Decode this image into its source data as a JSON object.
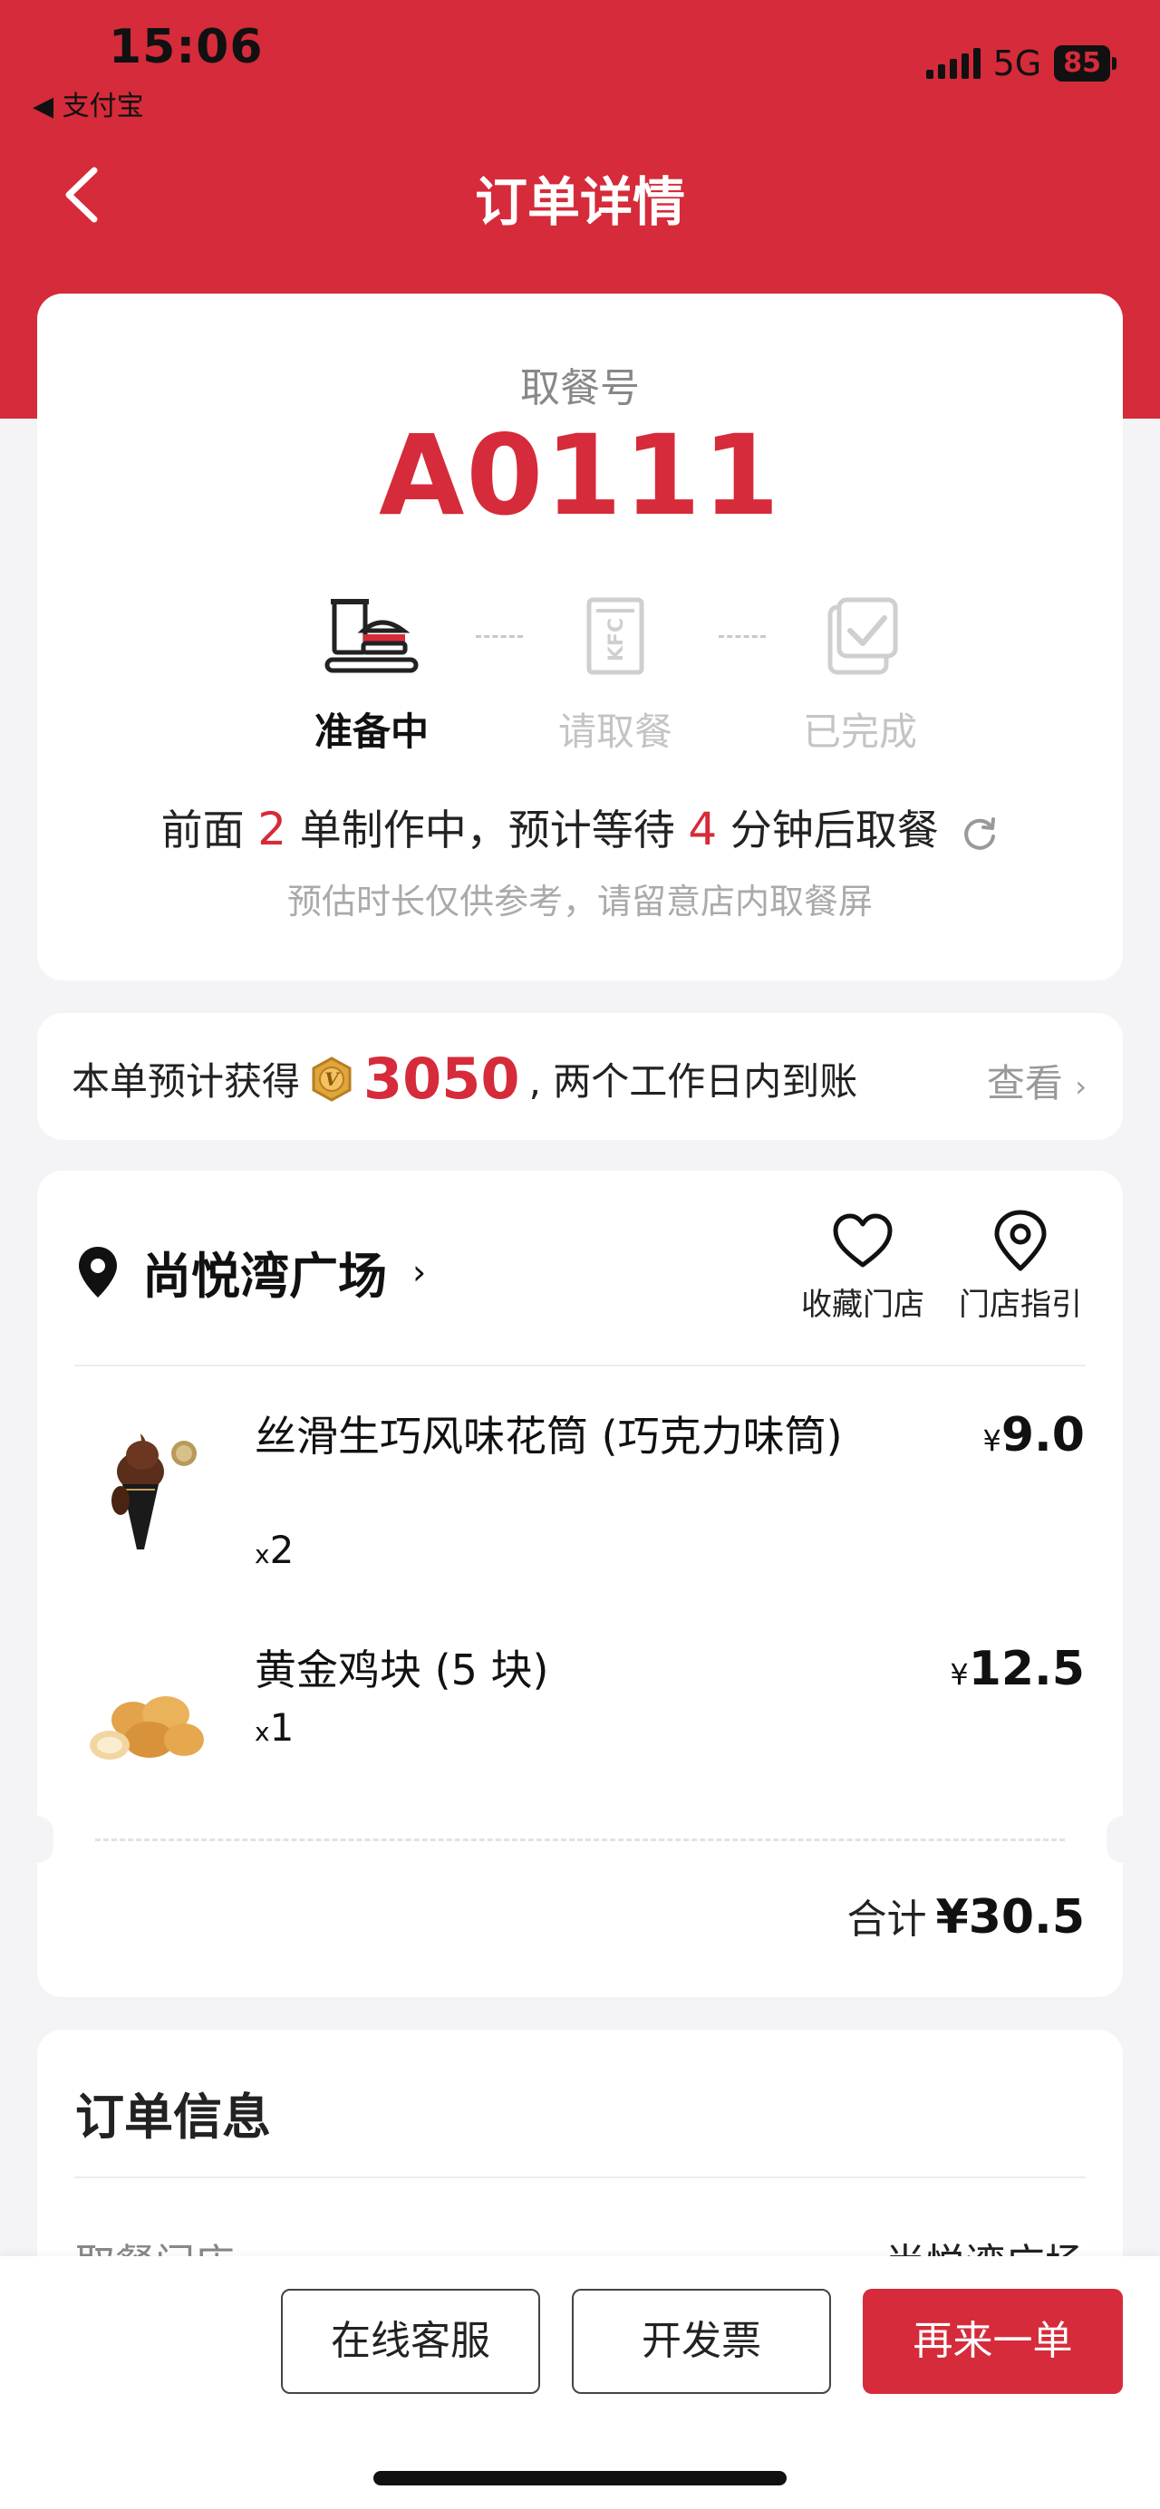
{
  "status_bar": {
    "time": "15:06",
    "back_app": "◀ 支付宝",
    "network": "5G",
    "battery": "85"
  },
  "nav": {
    "title": "订单详情",
    "back_icon": "chevron-left-icon"
  },
  "pickup": {
    "label": "取餐号",
    "number": "A0111",
    "steps": [
      {
        "label": "准备中",
        "icon": "burger-tray-icon",
        "active": true
      },
      {
        "label": "请取餐",
        "icon": "kfc-bag-icon",
        "active": false
      },
      {
        "label": "已完成",
        "icon": "check-bag-icon",
        "active": false
      }
    ],
    "wait": {
      "prefix": "前面",
      "orders_ahead": "2",
      "middle": "单制作中，预计等待",
      "minutes": "4",
      "suffix": "分钟后取餐"
    },
    "note": "预估时长仅供参考，请留意店内取餐屏"
  },
  "points": {
    "prefix": "本单预计获得",
    "amount": "3050",
    "suffix": ", 两个工作日内到账",
    "view_label": "查看"
  },
  "store": {
    "name": "尚悦湾广场",
    "fav_label": "收藏门店",
    "guide_label": "门店指引"
  },
  "items": [
    {
      "name": "丝滑生巧风味花筒 (巧克力味筒)",
      "qty": "2",
      "price": "9.0",
      "currency": "¥",
      "qty_prefix": "x"
    },
    {
      "name": "黄金鸡块 (5 块)",
      "qty": "1",
      "price": "12.5",
      "currency": "¥",
      "qty_prefix": "x"
    }
  ],
  "total": {
    "label": "合计",
    "amount": "¥30.5"
  },
  "order_info": {
    "title": "订单信息",
    "rows": [
      {
        "key": "取餐门店",
        "value": "尚悦湾广场"
      }
    ]
  },
  "actions": {
    "service": "在线客服",
    "invoice": "开发票",
    "reorder": "再来一单"
  },
  "colors": {
    "brand_red": "#d52b3a",
    "gold": "#d9a441"
  }
}
